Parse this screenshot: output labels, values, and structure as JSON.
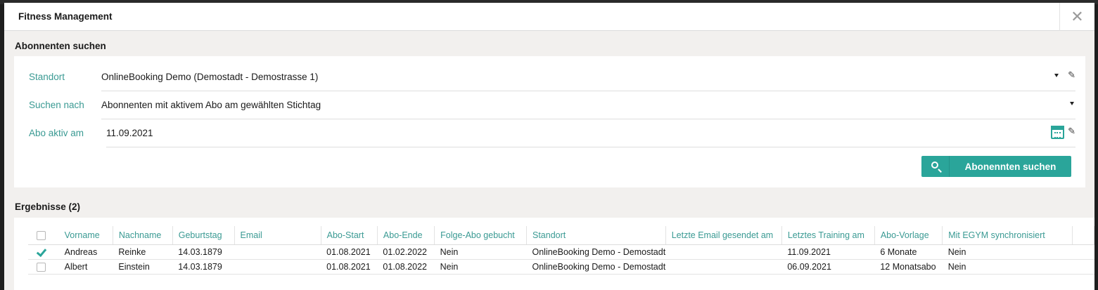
{
  "window": {
    "title": "Fitness Management"
  },
  "search": {
    "heading": "Abonnenten suchen",
    "standort_label": "Standort",
    "standort_value": "OnlineBooking Demo (Demostadt - Demostrasse 1)",
    "suchen_nach_label": "Suchen nach",
    "suchen_nach_value": "Abonnenten mit aktivem Abo am gewählten Stichtag",
    "abo_aktiv_label": "Abo aktiv am",
    "abo_aktiv_value": "11.09.2021",
    "button_label": "Abonennten suchen"
  },
  "results": {
    "heading": "Ergebnisse (2)",
    "columns": [
      "Vorname",
      "Nachname",
      "Geburtstag",
      "Email",
      "Abo-Start",
      "Abo-Ende",
      "Folge-Abo gebucht",
      "Standort",
      "Letzte Email gesendet am",
      "Letztes Training am",
      "Abo-Vorlage",
      "Mit EGYM synchronisiert"
    ],
    "rows": [
      {
        "checked": true,
        "vorname": "Andreas",
        "nachname": "Reinke",
        "geburtstag": "14.03.1879",
        "email": "",
        "abo_start": "01.08.2021",
        "abo_ende": "01.02.2022",
        "folge_abo": "Nein",
        "standort": "OnlineBooking Demo - Demostadt",
        "letzte_email": "",
        "letztes_training": "11.09.2021",
        "abo_vorlage": "6 Monate",
        "egym": "Nein"
      },
      {
        "checked": false,
        "vorname": "Albert",
        "nachname": "Einstein",
        "geburtstag": "14.03.1879",
        "email": "",
        "abo_start": "01.08.2021",
        "abo_ende": "01.08.2022",
        "folge_abo": "Nein",
        "standort": "OnlineBooking Demo - Demostadt",
        "letzte_email": "",
        "letztes_training": "06.09.2021",
        "abo_vorlage": "12 Monatsabo",
        "egym": "Nein"
      }
    ]
  },
  "colors": {
    "accent": "#2aa59a",
    "label": "#3a9a93",
    "panel_bg": "#f2f0ee"
  },
  "icons": [
    "close-icon",
    "caret-down-icon",
    "edit-pencil-icon",
    "calendar-icon",
    "search-icon",
    "check-icon"
  ]
}
